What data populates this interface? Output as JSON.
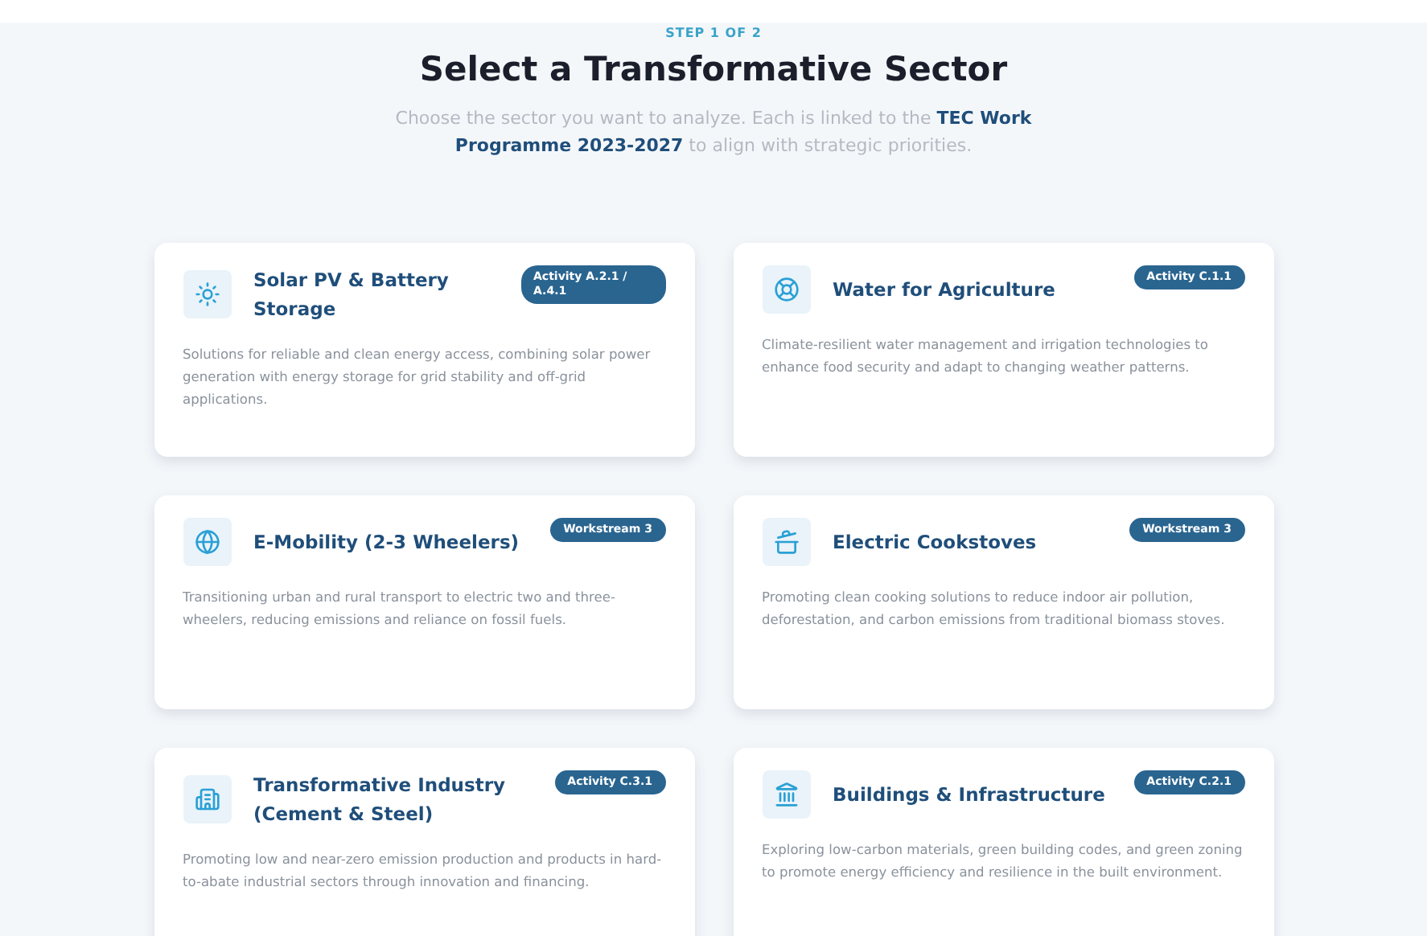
{
  "header": {
    "step": "STEP 1 OF 2",
    "title": "Select a Transformative Sector",
    "intro": "Choose the sector you want to analyze. Each is linked to the **TEC Work Programme 2023-2027** to align with strategic priorities."
  },
  "sectors": [
    {
      "title": "Solar PV & Battery Storage",
      "badge": "Activity A.2.1 / A.4.1",
      "description": "Solutions for reliable and clean energy access, combining solar power generation with energy storage for grid stability and off-grid applications."
    },
    {
      "title": "Water for Agriculture",
      "badge": "Activity C.1.1",
      "description": "Climate-resilient water management and irrigation technologies to enhance food security and adapt to changing weather patterns."
    },
    {
      "title": "E-Mobility (2-3 Wheelers)",
      "badge": "Workstream 3",
      "description": "Transitioning urban and rural transport to electric two and three-wheelers, reducing emissions and reliance on fossil fuels."
    },
    {
      "title": "Electric Cookstoves",
      "badge": "Workstream 3",
      "description": "Promoting clean cooking solutions to reduce indoor air pollution, deforestation, and carbon emissions from traditional biomass stoves."
    },
    {
      "title": "Transformative Industry (Cement & Steel)",
      "badge": "Activity C.3.1",
      "description": "Promoting low and near-zero emission production and products in hard-to-abate industrial sectors through innovation and financing."
    },
    {
      "title": "Buildings & Infrastructure",
      "badge": "Activity C.2.1",
      "description": "Exploring low-carbon materials, green building codes, and green zoning to promote energy efficiency and resilience in the built environment."
    }
  ]
}
